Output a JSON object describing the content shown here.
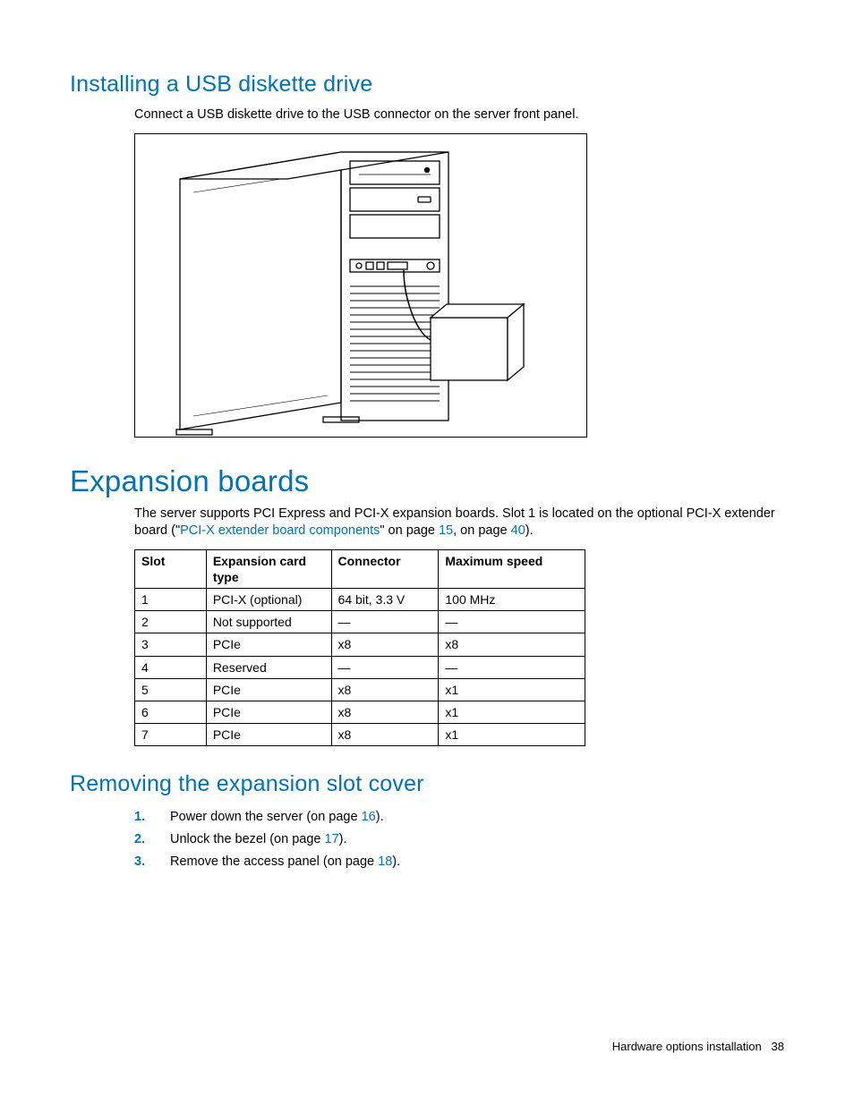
{
  "section1": {
    "heading": "Installing a USB diskette drive",
    "para": "Connect a USB diskette drive to the USB connector on the server front panel."
  },
  "section2": {
    "heading": "Expansion boards",
    "para_pre": "The server supports PCI Express and PCI-X expansion boards. Slot 1 is located on the optional PCI-X extender board (\"",
    "link1": "PCI-X extender board components",
    "para_mid1": "\" on page ",
    "link2": "15",
    "para_mid2": ", on page ",
    "link3": "40",
    "para_post": ").",
    "table": {
      "headers": [
        "Slot",
        "Expansion card type",
        "Connector",
        "Maximum speed"
      ],
      "rows": [
        [
          "1",
          "PCI-X (optional)",
          "64 bit, 3.3 V",
          "100 MHz"
        ],
        [
          "2",
          "Not supported",
          "—",
          "—"
        ],
        [
          "3",
          "PCIe",
          "x8",
          "x8"
        ],
        [
          "4",
          "Reserved",
          "—",
          "—"
        ],
        [
          "5",
          "PCIe",
          "x8",
          "x1"
        ],
        [
          "6",
          "PCIe",
          "x8",
          "x1"
        ],
        [
          "7",
          "PCIe",
          "x8",
          "x1"
        ]
      ]
    }
  },
  "section3": {
    "heading": "Removing the expansion slot cover",
    "steps": [
      {
        "pre": "Power down the server (on page ",
        "link": "16",
        "post": ")."
      },
      {
        "pre": "Unlock the bezel (on page ",
        "link": "17",
        "post": ")."
      },
      {
        "pre": "Remove the access panel (on page ",
        "link": "18",
        "post": ")."
      }
    ]
  },
  "footer": {
    "text": "Hardware options installation",
    "page": "38"
  }
}
